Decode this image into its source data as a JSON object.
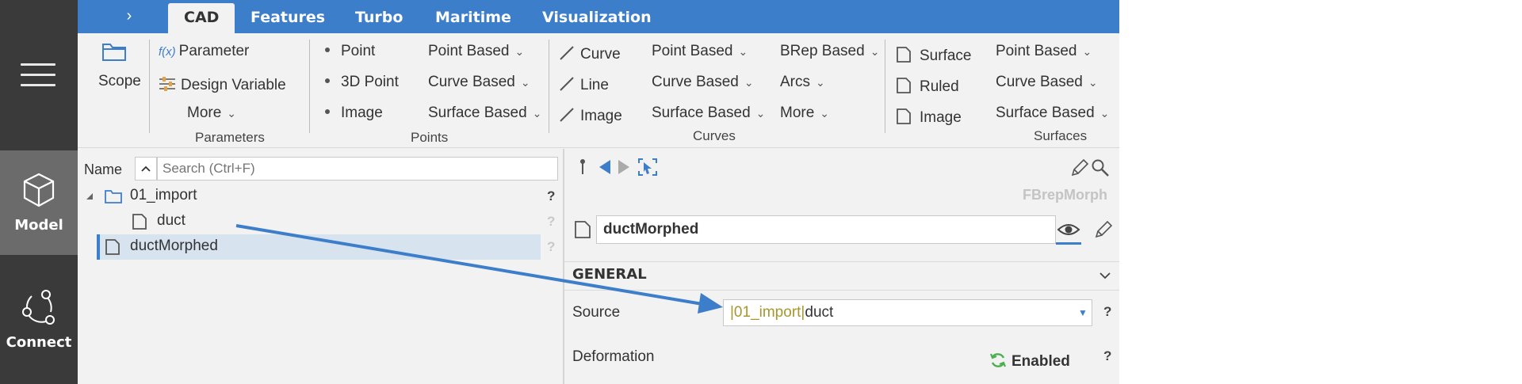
{
  "sidebar": {
    "items": [
      {
        "label": "Model"
      },
      {
        "label": "Connect"
      }
    ]
  },
  "tabs": [
    {
      "label": "CAD",
      "active": true
    },
    {
      "label": "Features"
    },
    {
      "label": "Turbo"
    },
    {
      "label": "Maritime"
    },
    {
      "label": "Visualization"
    }
  ],
  "ribbon": {
    "scope": "Scope",
    "parameters": {
      "parameter": "Parameter",
      "fx": "f(x)",
      "design_variable": "Design Variable",
      "more": "More",
      "group": "Parameters"
    },
    "points": {
      "point": "Point",
      "point_3d": "3D Point",
      "image": "Image",
      "point_based": "Point Based",
      "curve_based": "Curve Based",
      "surface_based": "Surface Based",
      "group": "Points"
    },
    "curves": {
      "curve": "Curve",
      "line": "Line",
      "image": "Image",
      "point_based": "Point Based",
      "curve_based": "Curve Based",
      "surface_based": "Surface Based",
      "brep_based": "BRep Based",
      "arcs": "Arcs",
      "more": "More",
      "group": "Curves"
    },
    "surfaces": {
      "surface": "Surface",
      "ruled": "Ruled",
      "image": "Image",
      "point_based": "Point Based",
      "curve_based": "Curve Based",
      "surface_based": "Surface Based",
      "group": "Surfaces"
    }
  },
  "tree": {
    "name_header": "Name",
    "search_placeholder": "Search (Ctrl+F)",
    "rows": [
      {
        "label": "01_import",
        "status": "?"
      },
      {
        "label": "duct",
        "status": "?"
      },
      {
        "label": "ductMorphed",
        "status": "?",
        "selected": true
      }
    ]
  },
  "properties": {
    "type_label": "FBrepMorph",
    "object_name": "ductMorphed",
    "section": "GENERAL",
    "source_label": "Source",
    "source_prefix": "|01_import|",
    "source_value": "duct",
    "deformation_label": "Deformation",
    "deformation_value": "Enabled",
    "help": "?"
  },
  "colors": {
    "accent": "#3d7ecb",
    "sidebar": "#3a3a3a",
    "enabled_icon": "#4caf50"
  }
}
